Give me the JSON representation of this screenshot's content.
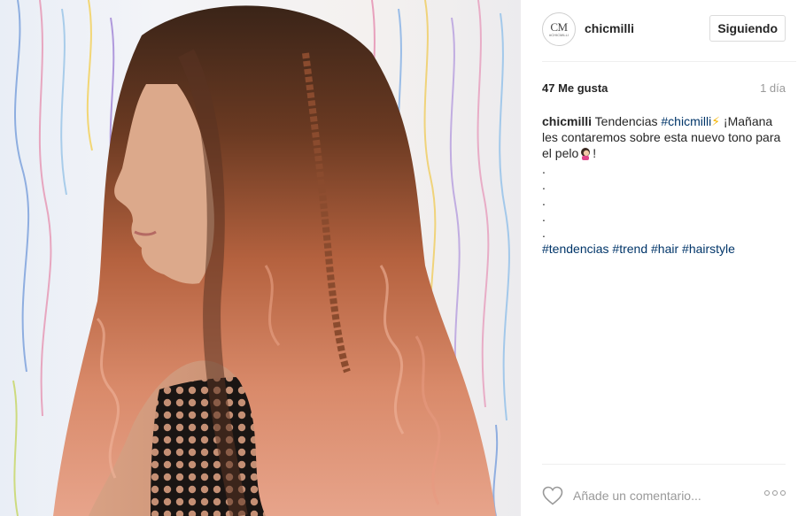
{
  "post": {
    "photo": {
      "description_icon": "photo-image"
    },
    "header": {
      "avatar_text": "CM",
      "avatar_small_text": "#CHICMILLI",
      "username": "chicmilli",
      "follow_label": "Siguiendo"
    },
    "likes": "47 Me gusta",
    "time": "1 día",
    "caption": {
      "author": "chicmilli",
      "text1": "Tendencias",
      "tag1": "#chicmilli",
      "bolt": "⚡",
      "text2": " ¡Mañana",
      "line2": "les contaremos sobre esta nuevo tono para",
      "line3": "el pelo",
      "exclaim": "!",
      "dots": [
        ".",
        ".",
        ".",
        ".",
        "."
      ],
      "tags": [
        "#tendencias",
        "#trend",
        "#hair",
        "#hairstyle"
      ]
    },
    "footer": {
      "comment_placeholder": "Añade un comentario...",
      "more_icon": "more-options-icon",
      "like_icon": "heart-icon"
    },
    "colors": {
      "link": "#003569",
      "muted": "#999999",
      "border": "#efefef"
    }
  }
}
